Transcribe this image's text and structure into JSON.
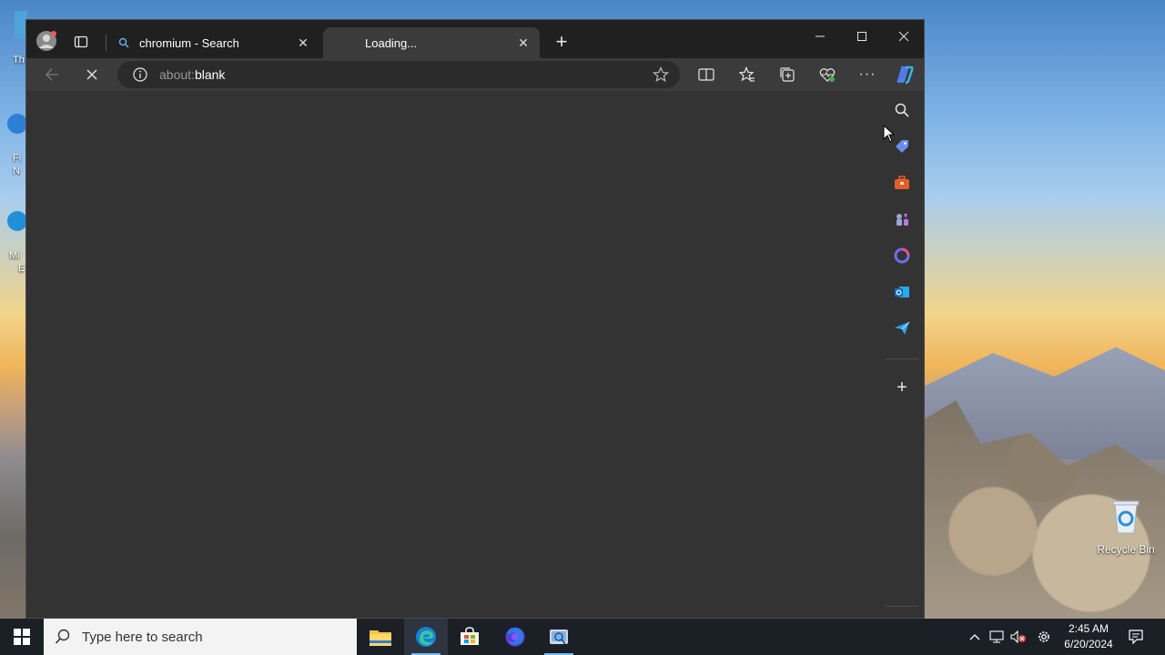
{
  "desktop": {
    "left_labels": [
      "Th",
      "Fi",
      "N",
      "Mi",
      "E"
    ],
    "recycle_bin_label": "Recycle Bin"
  },
  "browser": {
    "tabs": [
      {
        "label": "chromium - Search",
        "favicon": "search-icon",
        "active": false
      },
      {
        "label": "Loading...",
        "favicon": "none",
        "active": true
      }
    ],
    "address": {
      "scheme": "about:",
      "path": "blank"
    },
    "colors": {
      "frame": "#202020",
      "toolbar": "#3b3b3b",
      "content": "#333333",
      "accent": "#2f9ee8"
    }
  },
  "taskbar": {
    "search_placeholder": "Type here to search",
    "time": "2:45 AM",
    "date": "6/20/2024",
    "apps": [
      "file-explorer-icon",
      "edge-icon",
      "store-icon",
      "firefox-icon",
      "snipping-icon"
    ]
  }
}
